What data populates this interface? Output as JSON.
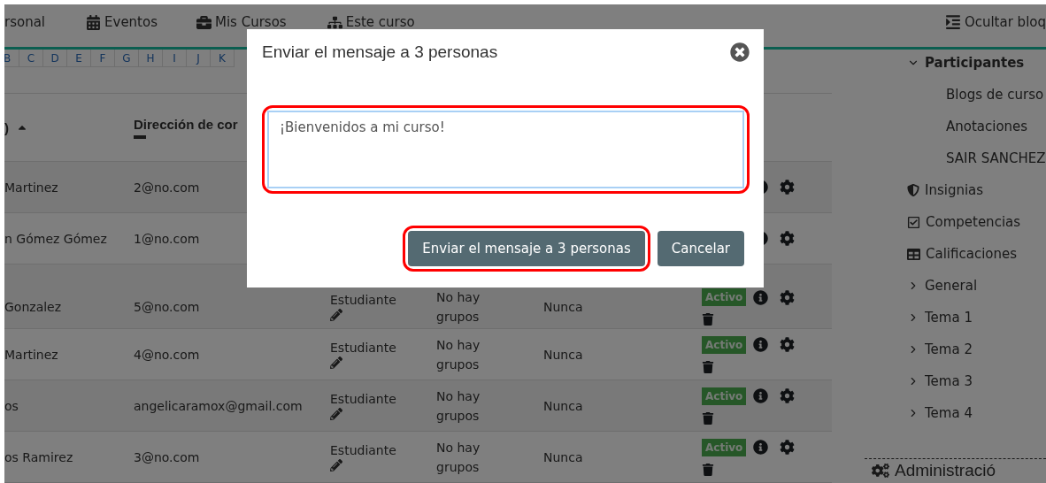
{
  "navbar": {
    "items": [
      "rsonal",
      "Eventos",
      "Mis Cursos",
      "Este curso"
    ],
    "toggle": "Ocultar bloq"
  },
  "alphabet": [
    "B",
    "C",
    "D",
    "E",
    "F",
    "G",
    "H",
    "I",
    "J",
    "K"
  ],
  "table": {
    "columns": [
      {
        "label": ")",
        "sorted": true
      },
      {
        "label": "Dirección de cor",
        "sorted": false
      }
    ],
    "rows": [
      {
        "name": "Martinez",
        "email": "2@no.com"
      },
      {
        "name": "n Gómez Gómez",
        "email": "1@no.com"
      },
      {
        "name": "Gonzalez",
        "email": "5@no.com",
        "role": "Estudiante",
        "groups": "No hay grupos",
        "last_access": "Nunca",
        "status": "Activo"
      },
      {
        "name": "Martinez",
        "email": "4@no.com",
        "role": "Estudiante",
        "groups": "No hay grupos",
        "last_access": "Nunca",
        "status": "Activo"
      },
      {
        "name": "os",
        "email": "angelicaramox@gmail.com",
        "role": "Estudiante",
        "groups": "No hay grupos",
        "last_access": "Nunca",
        "status": "Activo"
      },
      {
        "name": "os Ramirez",
        "email": "3@no.com",
        "role": "Estudiante",
        "groups": "No hay grupos",
        "last_access": "Nunca",
        "status": "Activo"
      }
    ]
  },
  "sidebar": {
    "items": [
      {
        "label": "Participantes",
        "kind": "tree",
        "expanded": true,
        "children": [
          {
            "label": "Blogs de curso"
          },
          {
            "label": "Anotaciones"
          },
          {
            "label": "SAIR SANCHEZ"
          }
        ]
      },
      {
        "label": "Insignias",
        "kind": "shield"
      },
      {
        "label": "Competencias",
        "kind": "check"
      },
      {
        "label": "Calificaciones",
        "kind": "grid"
      },
      {
        "label": "General",
        "kind": "tree",
        "expanded": false
      },
      {
        "label": "Tema 1",
        "kind": "tree",
        "expanded": false
      },
      {
        "label": "Tema 2",
        "kind": "tree",
        "expanded": false
      },
      {
        "label": "Tema 3",
        "kind": "tree",
        "expanded": false
      },
      {
        "label": "Tema 4",
        "kind": "tree",
        "expanded": false
      }
    ],
    "admin": "Administració"
  },
  "modal": {
    "title": "Enviar el mensaje a 3 personas",
    "message": {
      "value": "¡Bienvenidos a mi curso!",
      "highlighted": true
    },
    "buttons": [
      {
        "label": "Enviar el mensaje a 3 personas",
        "highlighted": true
      },
      {
        "label": "Cancelar",
        "highlighted": false
      }
    ]
  }
}
